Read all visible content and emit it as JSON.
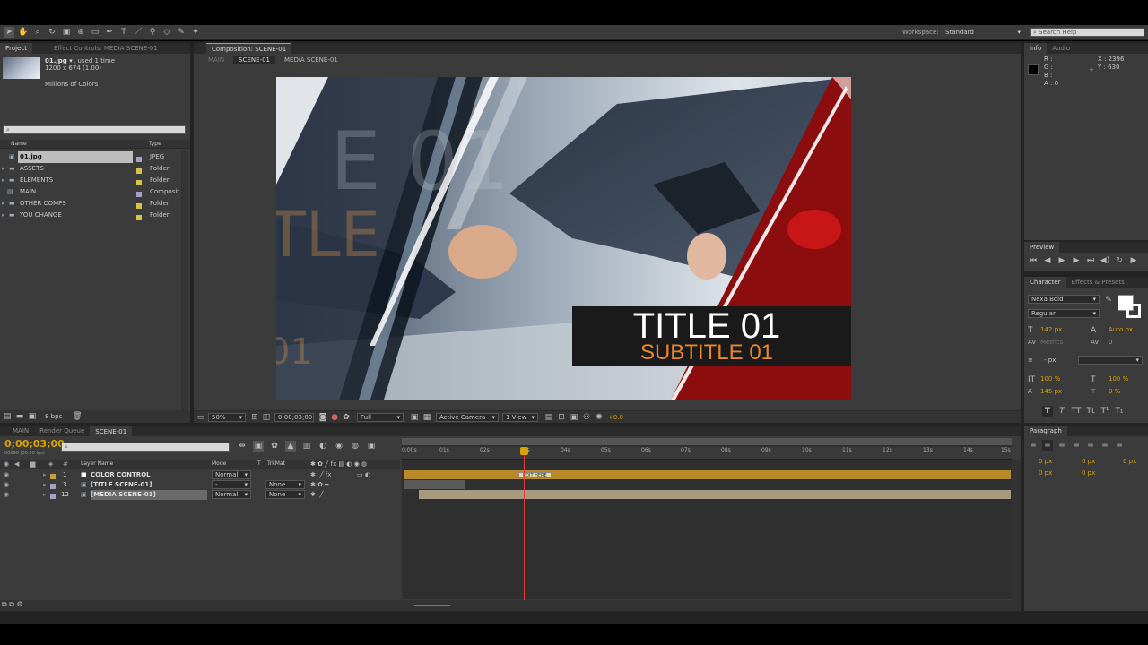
{
  "workspace": {
    "label": "Workspace:",
    "value": "Standard",
    "search_placeholder": "Search Help"
  },
  "project": {
    "tabs": [
      "Project",
      "Effect Controls: MEDIA SCENE-01"
    ],
    "file_name": "01.jpg ▾",
    "used": ", used 1 time",
    "dims": "1200 x 674 (1.00)",
    "colors": "Millions of Colors",
    "col_name": "Name",
    "col_type": "Type",
    "items": [
      {
        "name": "01.jpg",
        "type": "JPEG"
      },
      {
        "name": "ASSETS",
        "type": "Folder"
      },
      {
        "name": "ELEMENTS",
        "type": "Folder"
      },
      {
        "name": "MAIN",
        "type": "Composit"
      },
      {
        "name": "OTHER COMPS",
        "type": "Folder"
      },
      {
        "name": "YOU CHANGE",
        "type": "Folder"
      }
    ],
    "bpc": "8 bpc"
  },
  "comp": {
    "tab": "Composition: SCENE-01",
    "crumbs": [
      "MAIN",
      "SCENE-01",
      "MEDIA SCENE-01"
    ],
    "title": "TITLE 01",
    "subtitle": "SUBTITLE 01",
    "zoom": "50%",
    "timecode": "0;00;03;00",
    "resolution": "Full",
    "camera": "Active Camera",
    "view": "1 View",
    "exposure": "+0.0"
  },
  "info": {
    "tabs": [
      "Info",
      "Audio"
    ],
    "r": "R :",
    "g": "G :",
    "b": "B :",
    "a": "A : 0",
    "x": "X : 2396",
    "y": "Y : 630"
  },
  "preview": {
    "tab": "Preview"
  },
  "character": {
    "tabs": [
      "Character",
      "Effects & Presets"
    ],
    "font": "Nexa Bold",
    "style": "Regular",
    "size": "142 px",
    "leading": "Auto px",
    "kern": "Metrics",
    "track": "0",
    "stroke": "- px",
    "vscale": "100 %",
    "hscale": "100 %",
    "baseline": "145 px",
    "tsume": "0 %"
  },
  "paragraph": {
    "tab": "Paragraph",
    "v1": "0 px",
    "v2": "0 px",
    "v3": "0 px",
    "v4": "0 px",
    "v5": "0 px"
  },
  "timeline": {
    "tabs": [
      "MAIN",
      "Render Queue",
      "SCENE-01"
    ],
    "timecode": "0;00;03;00",
    "frame": "00090 (30.00 fps)",
    "col_layer": "Layer Name",
    "col_mode": "Mode",
    "col_t": "T",
    "col_trkmat": "TrkMat",
    "ticks": [
      "0:00s",
      "01s",
      "02s",
      "03s",
      "04s",
      "05s",
      "06s",
      "07s",
      "08s",
      "09s",
      "10s",
      "11s",
      "12s",
      "13s",
      "14s",
      "15s"
    ],
    "marker": "EDIT HERE",
    "layers": [
      {
        "num": "1",
        "name": "COLOR CONTROL",
        "mode": "Normal",
        "trkmat": ""
      },
      {
        "num": "3",
        "name": "[TITLE SCENE-01]",
        "mode": "-",
        "trkmat": "None"
      },
      {
        "num": "12",
        "name": "[MEDIA SCENE-01]",
        "mode": "Normal",
        "trkmat": "None"
      }
    ]
  },
  "colors": {
    "accent": "#d8a300",
    "orange": "#e8862a",
    "red": "#b01010"
  }
}
